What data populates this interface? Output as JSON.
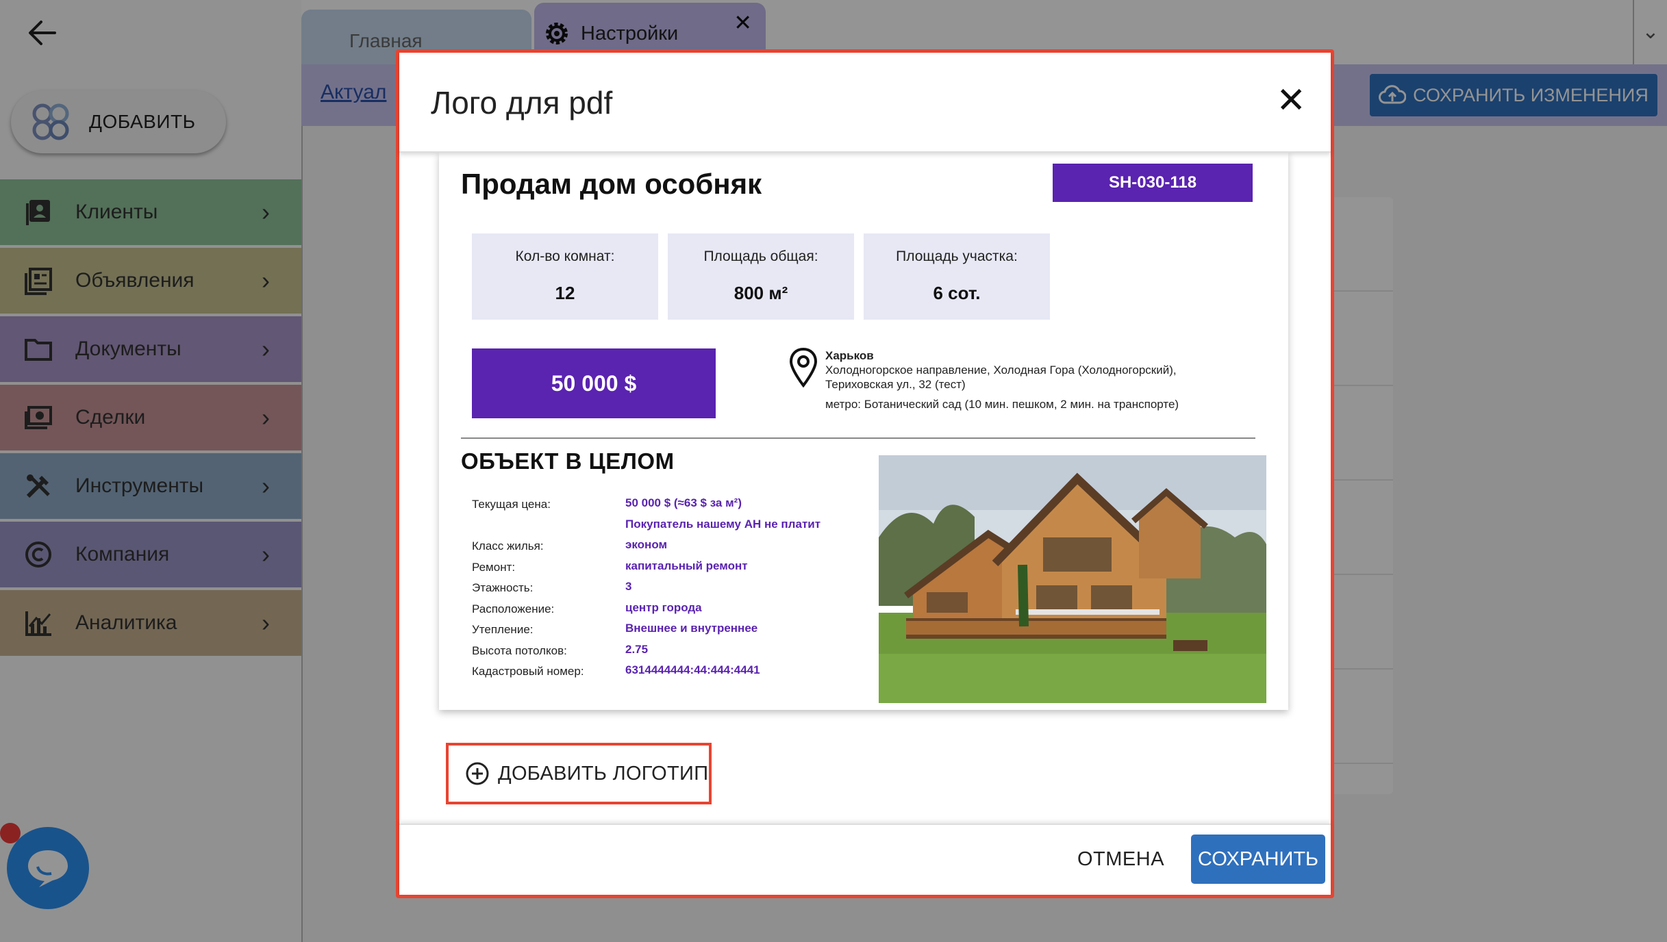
{
  "app": {
    "add_button_label": "ДОБАВИТЬ",
    "menu": [
      {
        "label": "Клиенты",
        "color": "#8fc29a",
        "icon": "contacts-icon"
      },
      {
        "label": "Объявления",
        "color": "#c6c291",
        "icon": "listings-icon"
      },
      {
        "label": "Документы",
        "color": "#aa96c9",
        "icon": "folder-icon"
      },
      {
        "label": "Сделки",
        "color": "#c89598",
        "icon": "money-icon"
      },
      {
        "label": "Инструменты",
        "color": "#8fabc6",
        "icon": "tools-icon"
      },
      {
        "label": "Компания",
        "color": "#9c97c9",
        "icon": "copyright-icon"
      },
      {
        "label": "Аналитика",
        "color": "#c7b291",
        "icon": "analytics-icon"
      }
    ],
    "tabs": {
      "main": "Главная",
      "settings": "Настройки",
      "close_glyph": "✕"
    },
    "subbar": {
      "link": "Актуал",
      "save_changes": "СОХРАНИТЬ ИЗМЕНЕНИЯ"
    }
  },
  "modal": {
    "title": "Лого для pdf",
    "close_glyph": "✕",
    "add_logo_label": "ДОБАВИТЬ ЛОГОТИП",
    "cancel_label": "ОТМЕНА",
    "save_label": "СОХРАНИТЬ",
    "pdf": {
      "title": "Продам дом особняк",
      "code": "SH-030-118",
      "stats": [
        {
          "label": "Кол-во комнат:",
          "value": "12"
        },
        {
          "label": "Площадь общая:",
          "value": "800 м²"
        },
        {
          "label": "Площадь участка:",
          "value": "6 сот."
        }
      ],
      "price": "50 000 $",
      "address": {
        "city": "Харьков",
        "line1": "Холодногорское направление, Холодная Гора (Холодногорский),",
        "line2": "Териховская ул., 32 (тест)",
        "metro": "метро: Ботанический сад (10 мин. пешком, 2 мин. на транспорте)"
      },
      "section_title": "ОБЪЕКТ В ЦЕЛОМ",
      "properties": [
        {
          "key": "Текущая цена:",
          "value": "50 000 $ (≈63 $ за м²)"
        },
        {
          "key": "",
          "value": "Покупатель нашему АН не платит"
        },
        {
          "key": "Класс жилья:",
          "value": "эконом"
        },
        {
          "key": "Ремонт:",
          "value": "капитальный ремонт"
        },
        {
          "key": "Этажность:",
          "value": "3"
        },
        {
          "key": "Расположение:",
          "value": "центр города"
        },
        {
          "key": "Утепление:",
          "value": "Внешнее и внутреннее"
        },
        {
          "key": "Высота потолков:",
          "value": "2.75"
        },
        {
          "key": "Кадастровый номер:",
          "value": "6314444444:44:444:4441"
        }
      ]
    }
  },
  "colors": {
    "accent": "#5a23b0",
    "primary_button": "#2f70bd",
    "highlight_border": "#e84431"
  }
}
